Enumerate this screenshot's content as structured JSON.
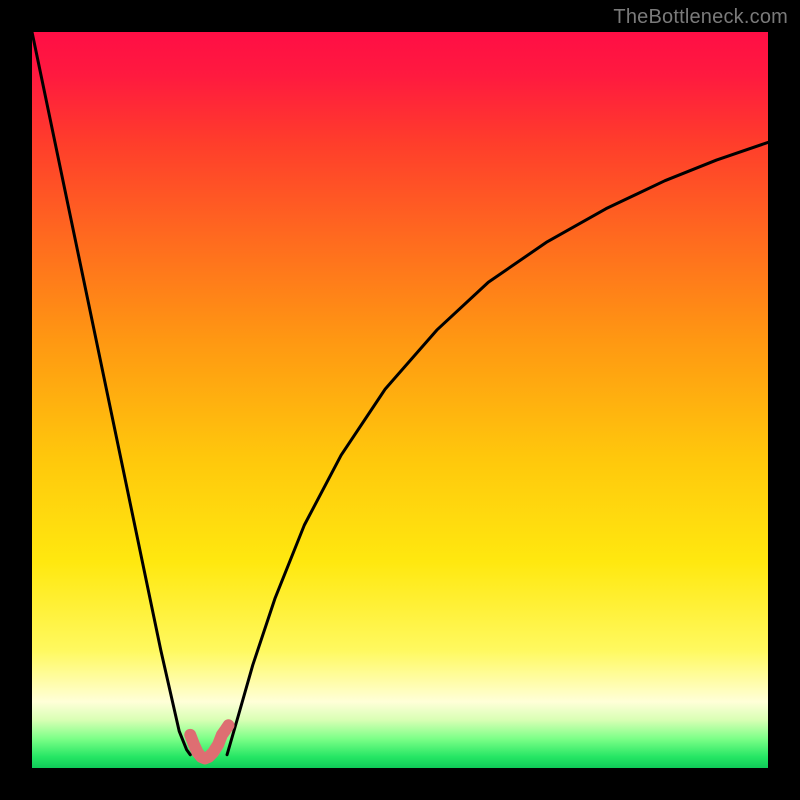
{
  "watermark": "TheBottleneck.com",
  "chart_data": {
    "type": "line",
    "title": "",
    "xlabel": "",
    "ylabel": "",
    "xlim": [
      0,
      100
    ],
    "ylim": [
      0,
      100
    ],
    "grid": false,
    "legend": false,
    "series": [
      {
        "name": "curve-left",
        "x": [
          0.0,
          2.5,
          5.0,
          7.5,
          10.0,
          12.5,
          15.0,
          17.5,
          20.0,
          21.0,
          21.5
        ],
        "values": [
          100.0,
          88.0,
          76.0,
          64.0,
          52.0,
          40.0,
          28.0,
          16.0,
          5.0,
          2.5,
          1.8
        ]
      },
      {
        "name": "valley-marker",
        "x": [
          21.5,
          22.0,
          22.5,
          23.0,
          23.5,
          24.0,
          24.6,
          25.3,
          25.8,
          26.3,
          26.7
        ],
        "values": [
          4.5,
          3.2,
          2.1,
          1.5,
          1.3,
          1.5,
          2.1,
          3.2,
          4.5,
          5.2,
          5.8
        ]
      },
      {
        "name": "curve-right",
        "x": [
          26.5,
          28.0,
          30.0,
          33.0,
          37.0,
          42.0,
          48.0,
          55.0,
          62.0,
          70.0,
          78.0,
          86.0,
          93.0,
          100.0
        ],
        "values": [
          1.8,
          7.0,
          14.0,
          23.0,
          33.0,
          42.5,
          51.5,
          59.5,
          66.0,
          71.5,
          76.0,
          79.8,
          82.6,
          85.0
        ]
      }
    ],
    "colors": {
      "curve": "#000000",
      "marker": "#de6e72"
    }
  }
}
